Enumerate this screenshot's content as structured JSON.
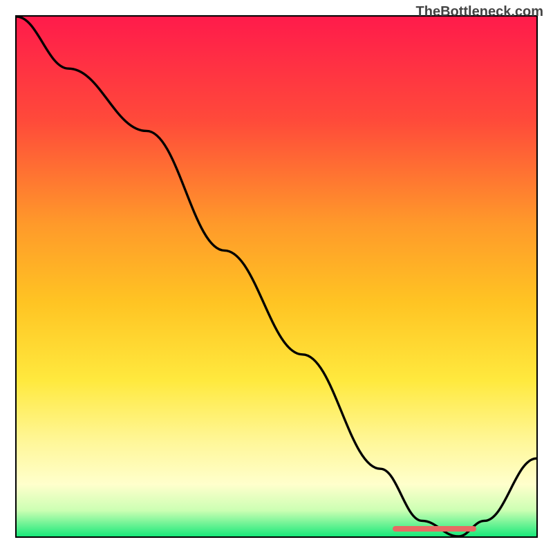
{
  "watermark": "TheBottleneck.com",
  "chart_data": {
    "type": "line",
    "title": "",
    "xlabel": "",
    "ylabel": "",
    "xlim": [
      0,
      100
    ],
    "ylim": [
      0,
      100
    ],
    "series": [
      {
        "name": "bottleneck-curve",
        "x": [
          0,
          10,
          25,
          40,
          55,
          70,
          78,
          85,
          90,
          100
        ],
        "values": [
          100,
          90,
          78,
          55,
          35,
          13,
          3,
          0,
          3,
          15
        ]
      }
    ],
    "gradient_stops": [
      {
        "pos": 0.0,
        "color": "#ff1b4b"
      },
      {
        "pos": 0.2,
        "color": "#ff4a3a"
      },
      {
        "pos": 0.4,
        "color": "#ff9a2a"
      },
      {
        "pos": 0.55,
        "color": "#ffc423"
      },
      {
        "pos": 0.7,
        "color": "#ffe93e"
      },
      {
        "pos": 0.82,
        "color": "#fff79a"
      },
      {
        "pos": 0.9,
        "color": "#ffffcc"
      },
      {
        "pos": 0.95,
        "color": "#ccffb3"
      },
      {
        "pos": 1.0,
        "color": "#19e87a"
      }
    ],
    "optimal_marker": {
      "x_start": 72,
      "x_end": 88,
      "y": 2,
      "color": "#e86a63"
    }
  }
}
